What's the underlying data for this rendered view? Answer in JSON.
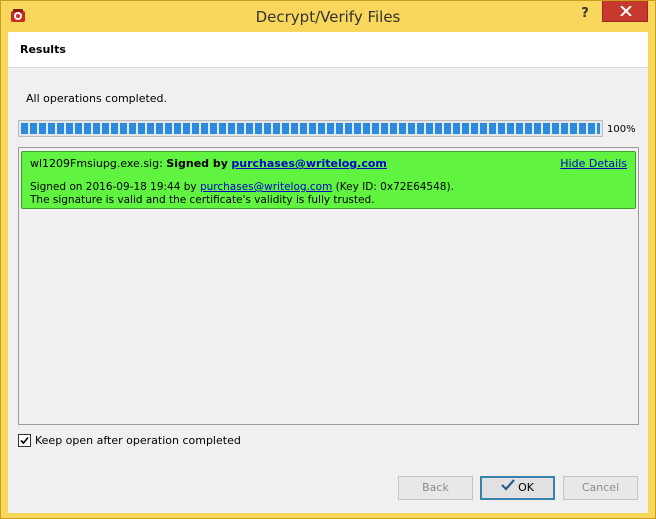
{
  "window": {
    "title": "Decrypt/Verify Files",
    "help_label": "?",
    "colors": {
      "titlebar": "#f9d75c",
      "close": "#c7392e"
    }
  },
  "header": {
    "title": "Results"
  },
  "status": {
    "text": "All operations completed."
  },
  "progress": {
    "value": 1.0,
    "label": "100%"
  },
  "results": [
    {
      "filename": "wl1209Fmsiupg.exe.sig:",
      "signed_by_label": "Signed by",
      "signer": "purchases@writelog.com",
      "details_toggle": "Hide Details",
      "signed_on_prefix": "Signed on 2016-09-18 19:44 by",
      "signed_on_signer": "purchases@writelog.com",
      "key_id": "(Key ID: 0x72E64548).",
      "validity": "The signature is valid and the certificate's validity is fully trusted.",
      "color": "#60f440"
    }
  ],
  "keep_open": {
    "label": "Keep open after operation completed",
    "checked": true
  },
  "buttons": {
    "back": "Back",
    "ok": "OK",
    "cancel": "Cancel"
  }
}
